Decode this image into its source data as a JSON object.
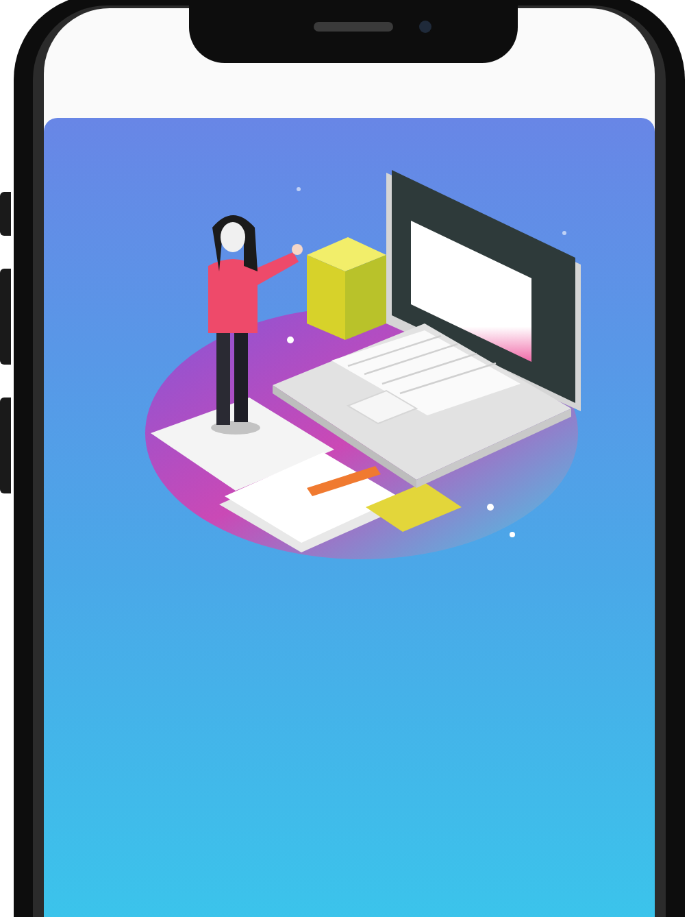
{
  "device": {
    "kind": "phone"
  },
  "screen": {
    "kind": "illustration"
  }
}
